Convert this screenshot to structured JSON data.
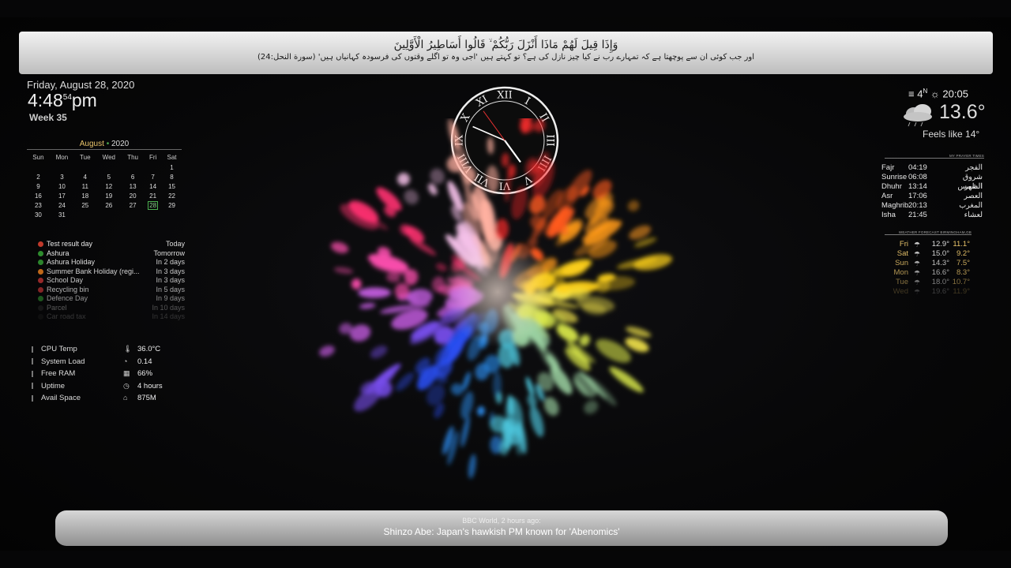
{
  "banner": {
    "arabic": "وَإِذَا قِيلَ لَهُمْ مَاذَا أَنْزَلَ رَبُّكُمْ ۙ قَالُوا أَسَاطِيرُ الْأَوَّلِينَ",
    "urdu": "اور جب کوئی ان سے پوچھتا ہے کہ تمہارے رب نے کیا چیز نازل کی ہے؟ تو کہتے ہیں 'اجی وہ تو اگلے وقتوں کی فرسودہ کہانیاں ہیں' (سورة النحل:24)"
  },
  "clock": {
    "date": "Friday, August 28, 2020",
    "time": "4:48",
    "seconds": "54",
    "ampm": "pm",
    "week": "Week 35",
    "roman": [
      "XII",
      "I",
      "II",
      "III",
      "IIII",
      "V",
      "VI",
      "VII",
      "VIII",
      "IX",
      "X",
      "XI"
    ]
  },
  "calendar": {
    "month": "August",
    "year": "2020",
    "weekdays": [
      "Sun",
      "Mon",
      "Tue",
      "Wed",
      "Thu",
      "Fri",
      "Sat"
    ],
    "weeks": [
      [
        "",
        "",
        "",
        "",
        "",
        "",
        "1"
      ],
      [
        "2",
        "3",
        "4",
        "5",
        "6",
        "7",
        "8"
      ],
      [
        "9",
        "10",
        "11",
        "12",
        "13",
        "14",
        "15"
      ],
      [
        "16",
        "17",
        "18",
        "19",
        "20",
        "21",
        "22"
      ],
      [
        "23",
        "24",
        "25",
        "26",
        "27",
        "28",
        "29"
      ],
      [
        "30",
        "31",
        "",
        "",
        "",
        "",
        ""
      ]
    ],
    "today": "28"
  },
  "events": [
    {
      "name": "Test result day",
      "when": "Today",
      "color": "#c0392b",
      "opacity": 1
    },
    {
      "name": "Ashura",
      "when": "Tomorrow",
      "color": "#2e8b2e",
      "opacity": 1
    },
    {
      "name": "Ashura Holiday",
      "when": "In 2 days",
      "color": "#2e8b2e",
      "opacity": 0.95
    },
    {
      "name": "Summer Bank Holiday (regi...",
      "when": "In 3 days",
      "color": "#d4731c",
      "opacity": 0.9
    },
    {
      "name": "School Day",
      "when": "In 3 days",
      "color": "#b03030",
      "opacity": 0.85
    },
    {
      "name": "Recycling bin",
      "when": "In 5 days",
      "color": "#b03030",
      "opacity": 0.75
    },
    {
      "name": "Defence Day",
      "when": "In 9 days",
      "color": "#2e8b2e",
      "opacity": 0.6
    },
    {
      "name": "Parcel",
      "when": "In 10 days",
      "color": "#333",
      "opacity": 0.35
    },
    {
      "name": "Car road tax",
      "when": "In 14 days",
      "color": "#333",
      "opacity": 0.2
    }
  ],
  "stats": [
    {
      "label": "CPU Temp",
      "icon": "thermometer-icon",
      "glyph": "🌡",
      "value": "36.0°C"
    },
    {
      "label": "System Load",
      "icon": "gauge-icon",
      "glyph": "◔",
      "value": "0.14"
    },
    {
      "label": "Free RAM",
      "icon": "memory-icon",
      "glyph": "▦",
      "value": "66%"
    },
    {
      "label": "Uptime",
      "icon": "clock-icon",
      "glyph": "◷",
      "value": "4 hours"
    },
    {
      "label": "Avail Space",
      "icon": "disk-icon",
      "glyph": "⌂",
      "value": "875M"
    }
  ],
  "weather": {
    "wind": "4",
    "sunset": "20:05",
    "temp": "13.6°",
    "feels": "Feels like 14°"
  },
  "prayer": {
    "header": "MY PRAYER TIMES",
    "rows": [
      {
        "name": "Fajr",
        "time": "04:19",
        "arabic": "الفجر"
      },
      {
        "name": "Sunrise",
        "time": "06:08",
        "arabic": "شروق الشمس"
      },
      {
        "name": "Dhuhr",
        "time": "13:14",
        "arabic": "الظهر"
      },
      {
        "name": "Asr",
        "time": "17:06",
        "arabic": "العصر"
      },
      {
        "name": "Maghrib",
        "time": "20:13",
        "arabic": "المغرب"
      },
      {
        "name": "Isha",
        "time": "21:45",
        "arabic": "لعشاء"
      }
    ]
  },
  "forecast": {
    "header": "WEATHER FORECAST BIRMINGHAM,GB",
    "rows": [
      {
        "day": "Fri",
        "high": "12.9°",
        "low": "11.1°",
        "opacity": 1
      },
      {
        "day": "Sat",
        "high": "15.0°",
        "low": "9.2°",
        "opacity": 0.95
      },
      {
        "day": "Sun",
        "high": "14.3°",
        "low": "7.5°",
        "opacity": 0.85
      },
      {
        "day": "Mon",
        "high": "16.6°",
        "low": "8.3°",
        "opacity": 0.75
      },
      {
        "day": "Tue",
        "high": "18.0°",
        "low": "10.7°",
        "opacity": 0.55
      },
      {
        "day": "Wed",
        "high": "19.6°",
        "low": "11.9°",
        "opacity": 0.25
      }
    ]
  },
  "news": {
    "source": "BBC World, 2 hours ago:",
    "headline": "Shinzo Abe: Japan's hawkish PM known for 'Abenomics'"
  }
}
